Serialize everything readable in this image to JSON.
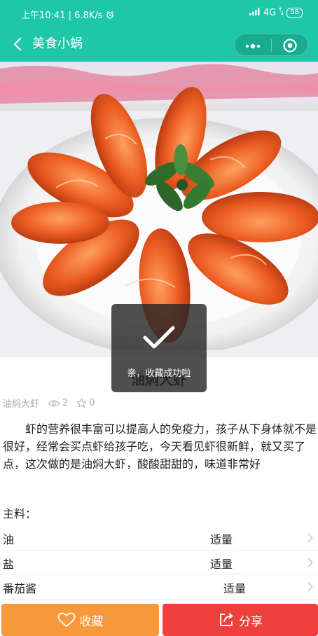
{
  "status": {
    "time": "上午10:41",
    "speed": "6.8K/s",
    "network": "4G",
    "battery": "58"
  },
  "nav": {
    "title": "美食小蜗"
  },
  "recipe": {
    "title": "油焖大虾",
    "name": "油焖大虾",
    "views": "2",
    "favorites": "0",
    "description": "虾的营养很丰富可以提高人的免疫力，孩子从下身体就不是很好，经常会买点虾给孩子吃，今天看见虾很新鲜，就又买了点，这次做的是油焖大虾，酸酸甜甜的，味道非常好"
  },
  "ingredients": {
    "label": "主料：",
    "items": [
      {
        "name": "油",
        "amount": "适量"
      },
      {
        "name": "盐",
        "amount": "适量"
      },
      {
        "name": "番茄酱",
        "amount": "适量"
      }
    ]
  },
  "actions": {
    "favorite": "收藏",
    "share": "分享"
  },
  "toast": {
    "message": "亲，收藏成功啦"
  },
  "colors": {
    "nav": "#1ec7a8",
    "favorite_button": "#f7993a",
    "share_button": "#f0403d"
  }
}
